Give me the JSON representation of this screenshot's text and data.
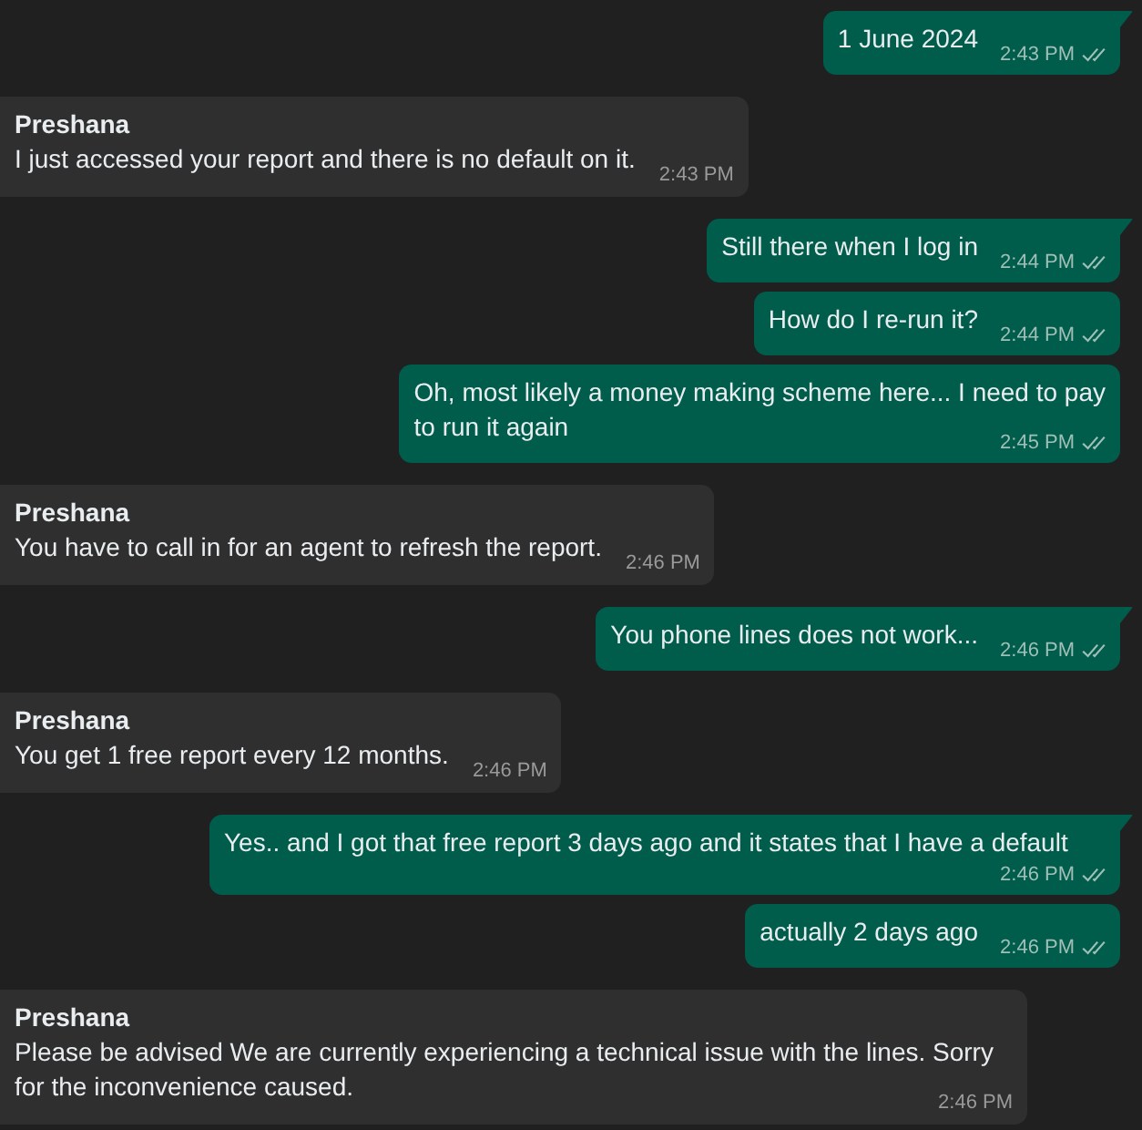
{
  "messages": [
    {
      "kind": "outgoing",
      "text": "1 June 2024",
      "time": "2:43 PM",
      "read": false
    },
    {
      "kind": "incoming",
      "sender": "Preshana",
      "text": "I just accessed your report and there is no default on it.",
      "time": "2:43 PM"
    },
    {
      "kind": "outgoing",
      "text": "Still there when I log in",
      "time": "2:44 PM",
      "read": false
    },
    {
      "kind": "outgoing",
      "text": "How do I re-run it?",
      "time": "2:44 PM",
      "read": false
    },
    {
      "kind": "outgoing",
      "text": "Oh, most likely a money making scheme here... I need to pay\nto run it again",
      "time": "2:45 PM",
      "read": false
    },
    {
      "kind": "incoming",
      "sender": "Preshana",
      "text": "You have to call in for an agent to refresh the report.",
      "time": "2:46 PM"
    },
    {
      "kind": "outgoing",
      "text": "You phone lines does not work...",
      "time": "2:46 PM",
      "read": false
    },
    {
      "kind": "incoming",
      "sender": "Preshana",
      "text": "You get 1 free report every 12 months.",
      "time": "2:46 PM"
    },
    {
      "kind": "outgoing",
      "text": "Yes.. and I got that free report 3 days ago and it states that I have a default",
      "time": "2:46 PM",
      "read": false
    },
    {
      "kind": "outgoing",
      "text": "actually 2 days ago",
      "time": "2:46 PM",
      "read": false
    },
    {
      "kind": "incoming",
      "sender": "Preshana",
      "text": "Please be advised We are currently experiencing a technical issue with the lines. Sorry for the inconvenience caused.",
      "time": "2:46 PM"
    }
  ]
}
